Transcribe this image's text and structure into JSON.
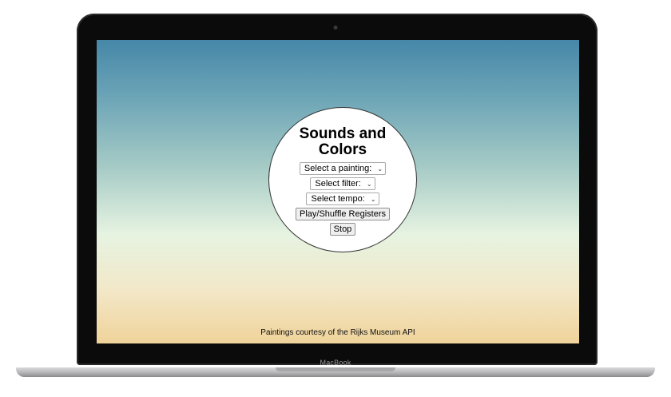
{
  "app": {
    "title": "Sounds and Colors",
    "title_line1": "Sounds and",
    "title_line2": "Colors"
  },
  "controls": {
    "painting_select": {
      "selected": "Select a painting:"
    },
    "filter_select": {
      "selected": "Select filter:"
    },
    "tempo_select": {
      "selected": "Select tempo:"
    },
    "play_button_label": "Play/Shuffle Registers",
    "stop_button_label": "Stop"
  },
  "footer": {
    "credits": "Paintings courtesy of the Rijks Museum API"
  },
  "device": {
    "brand": "MacBook"
  },
  "colors": {
    "gradient_top": "#4687a8",
    "gradient_middle": "#e6f3e1",
    "gradient_bottom": "#f0d39a",
    "circle_background": "#ffffff"
  },
  "icons": {
    "dropdown": "chevron-down-icon"
  }
}
